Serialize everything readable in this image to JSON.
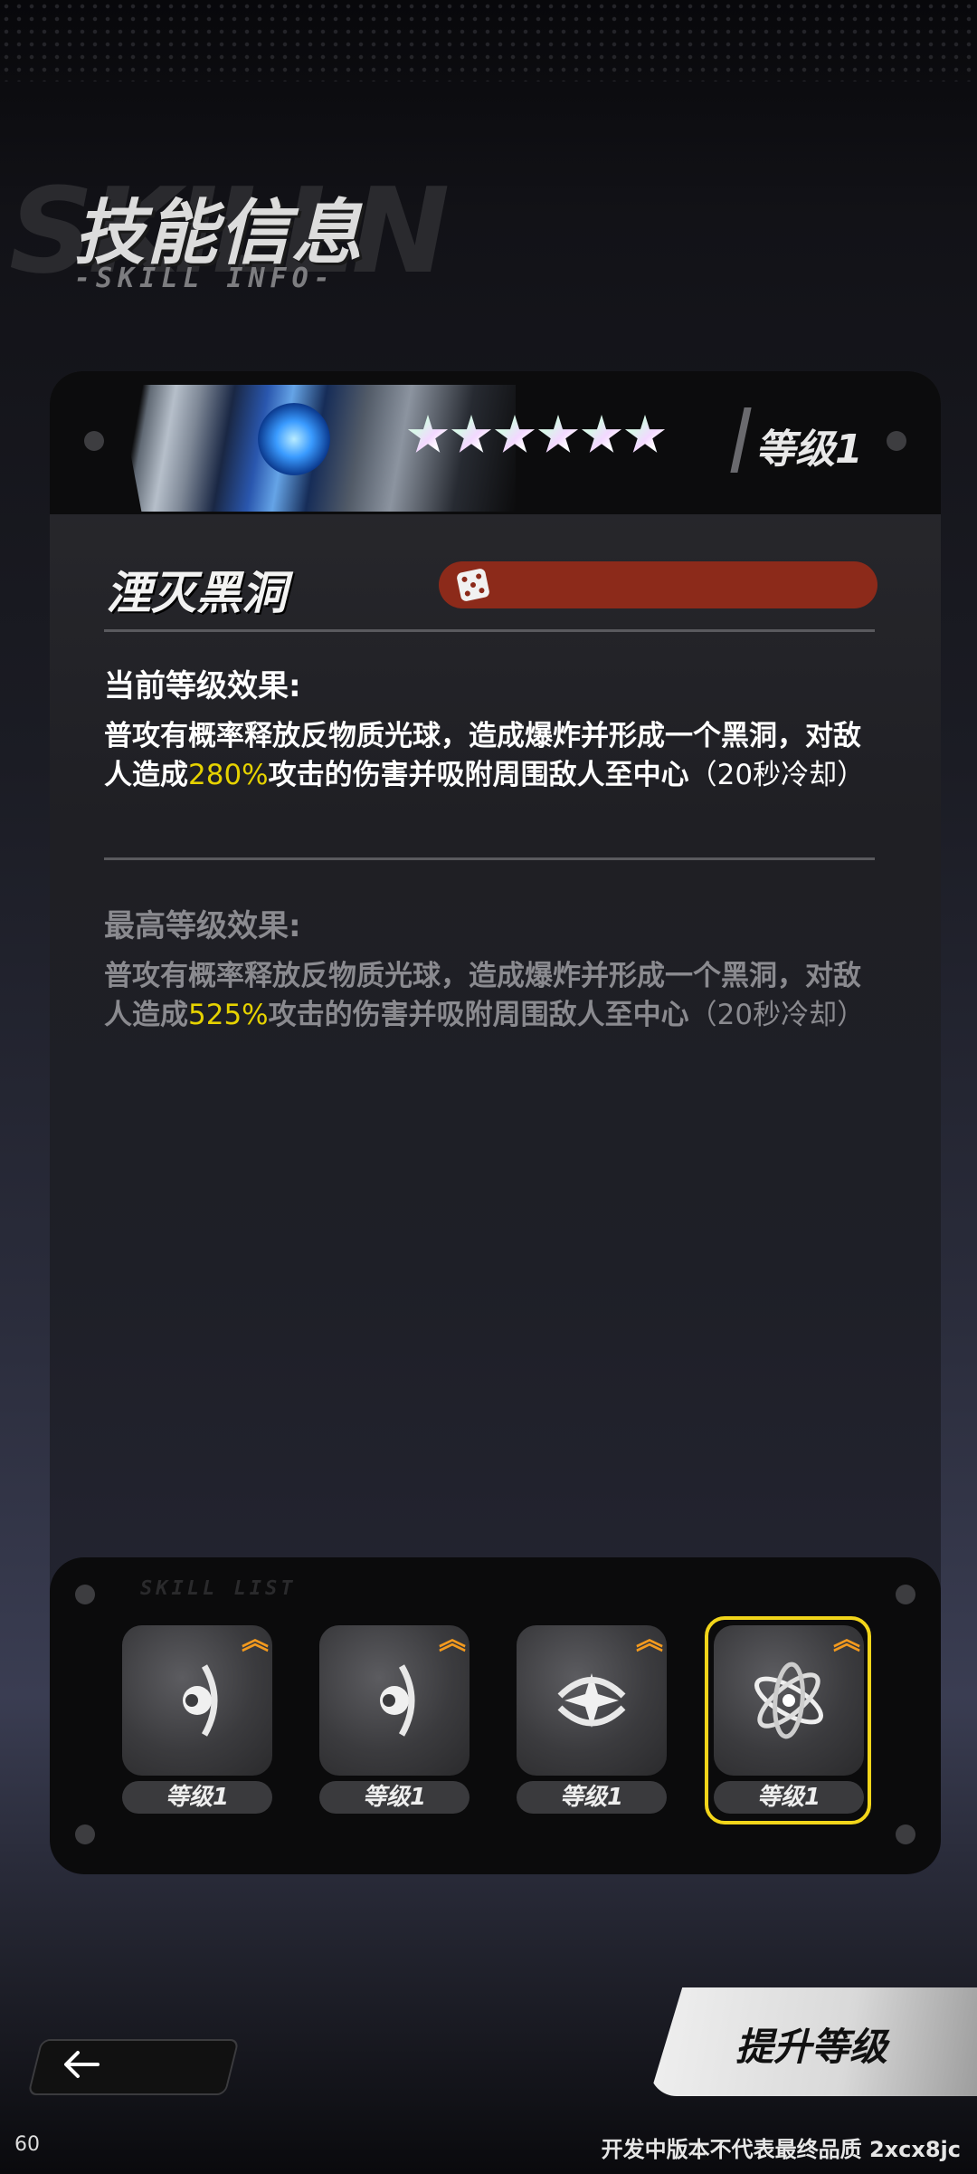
{
  "header": {
    "title": "技能信息",
    "subtitle": "-SKILL INFO-",
    "bg_letters": "SKILLN"
  },
  "skill_card": {
    "stars": 6,
    "level": "等级1",
    "skill_name": "湮灭黑洞",
    "skill_tag_icon": "dice-icon",
    "current": {
      "title": "当前等级效果:",
      "text_before": "普攻有概率释放反物质光球，造成爆炸并形成一个黑洞，对敌人造成",
      "value": "280%",
      "text_after": "攻击的伤害并吸附周围敌人至中心",
      "cooldown": "（20秒冷却）"
    },
    "max": {
      "title": "最高等级效果:",
      "text_before": "普攻有概率释放反物质光球，造成爆炸并形成一个黑洞，对敌人造成",
      "value": "525%",
      "text_after": "攻击的伤害并吸附周围敌人至中心",
      "cooldown": "（20秒冷却）"
    }
  },
  "skill_list": {
    "label": "SKILL LIST",
    "slots": [
      {
        "icon": "ring-planet-icon",
        "level": "等级1",
        "upgrade_icon": "double-chevron-up-icon"
      },
      {
        "icon": "ring-planet-icon",
        "level": "等级1",
        "upgrade_icon": "double-chevron-up-icon"
      },
      {
        "icon": "star-orbit-icon",
        "level": "等级1",
        "upgrade_icon": "double-chevron-up-icon"
      },
      {
        "icon": "atom-icon",
        "level": "等级1",
        "upgrade_icon": "double-chevron-up-icon",
        "selected": true
      }
    ]
  },
  "footer": {
    "upgrade_label": "提升等级",
    "back_icon": "arrow-left-icon",
    "fps": "60",
    "watermark": "开发中版本不代表最终品质 2xcx8jc"
  },
  "colors": {
    "highlight_value": "#e6d200",
    "selected_border": "#f2d51a",
    "upgrade_arrow": "#f39a1e",
    "tag_bar": "#8c2a1a"
  }
}
